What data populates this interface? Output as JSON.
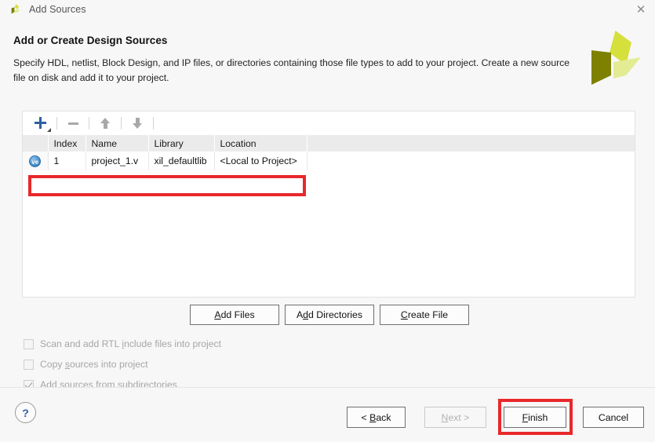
{
  "window": {
    "title": "Add Sources",
    "app_icon": "xilinx-vivado-icon",
    "close_label": "✕"
  },
  "header": {
    "heading": "Add or Create Design Sources",
    "description": "Specify HDL, netlist, Block Design, and IP files, or directories containing those file types to add to your project. Create a new source file on disk and add it to your project.",
    "logo": "xilinx-logo"
  },
  "toolbar": {
    "buttons": [
      {
        "name": "add-source-button",
        "icon": "plus-icon"
      },
      {
        "name": "remove-source-button",
        "icon": "minus-icon"
      },
      {
        "name": "move-up-button",
        "icon": "arrow-up-icon"
      },
      {
        "name": "move-down-button",
        "icon": "arrow-down-icon"
      }
    ]
  },
  "table": {
    "columns": [
      "",
      "Index",
      "Name",
      "Library",
      "Location",
      ""
    ],
    "rows": [
      {
        "icon": "ve",
        "icon_title": "verilog-file-icon",
        "index": "1",
        "name": "project_1.v",
        "library": "xil_defaultlib",
        "location": "<Local to Project>"
      }
    ]
  },
  "actions": {
    "add_files": "Add Files",
    "add_files_mnemonic": "A",
    "add_directories_pre": "A",
    "add_directories_mnemonic": "d",
    "add_directories_post": "d Directories",
    "create_file_mnemonic": "C",
    "create_file_post": "reate File"
  },
  "options": [
    {
      "label": "Scan and add RTL include files into project",
      "checked": false,
      "enabled": false,
      "mnemonic": "i"
    },
    {
      "label": "Copy sources into project",
      "checked": false,
      "enabled": false,
      "mnemonic": "s"
    },
    {
      "label": "Add sources from subdirectories",
      "checked": true,
      "enabled": false,
      "mnemonic": "u"
    }
  ],
  "footer": {
    "help": "?",
    "back": "< Back",
    "next": "Next >",
    "finish": "Finish",
    "cancel": "Cancel"
  },
  "annotations": [
    {
      "name": "highlight-source-row",
      "color": "#e8282b"
    },
    {
      "name": "highlight-finish-button",
      "color": "#e8282b"
    }
  ],
  "colors": {
    "accent_blue": "#2e5fa3",
    "annotation_red": "#e8282b",
    "logo_dark": "#7d8000",
    "logo_bright": "#d6e03c",
    "logo_light": "#e3eb93",
    "panel_bg": "#f7f7f7",
    "table_header_bg": "#ebebeb"
  }
}
